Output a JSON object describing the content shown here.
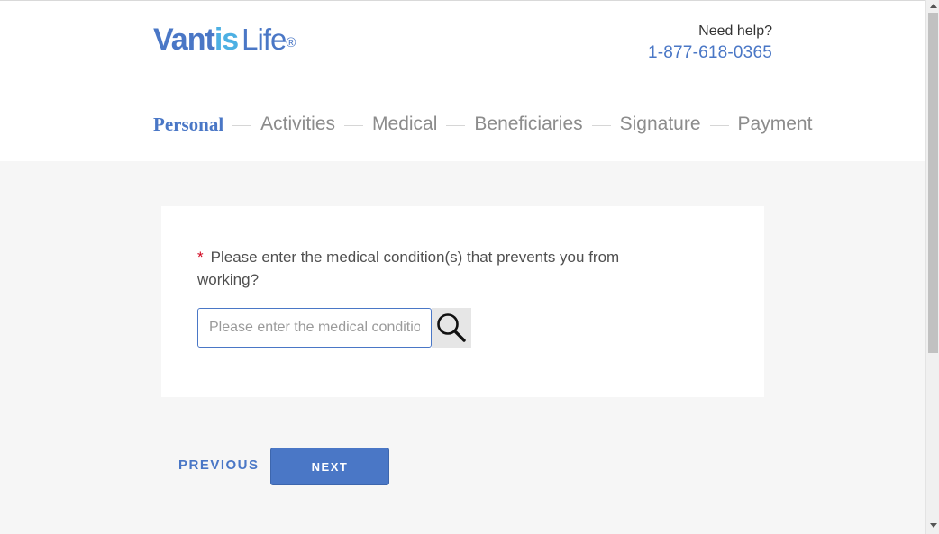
{
  "header": {
    "logo": {
      "brand_part1": "Vant",
      "brand_part2": "is",
      "brand_part3": "Life",
      "registered": "®"
    },
    "help_label": "Need help?",
    "help_phone": "1-877-618-0365"
  },
  "steps": [
    {
      "label": "Personal",
      "active": true
    },
    {
      "label": "Activities",
      "active": false
    },
    {
      "label": "Medical",
      "active": false
    },
    {
      "label": "Beneficiaries",
      "active": false
    },
    {
      "label": "Signature",
      "active": false
    },
    {
      "label": "Payment",
      "active": false
    }
  ],
  "form": {
    "required_marker": "*",
    "question": "Please enter the medical condition(s) that prevents you from working?",
    "input_value": "",
    "input_placeholder": "Please enter the medical condition(s)",
    "search_icon": "search-icon"
  },
  "buttons": {
    "previous_label": "PREVIOUS",
    "next_label": "NEXT"
  },
  "colors": {
    "brand_blue": "#4a77c6",
    "brand_light_blue": "#4db0e3",
    "required_red": "#d0021b",
    "inactive_step": "#8c8c8c",
    "page_background": "#f6f6f6"
  }
}
